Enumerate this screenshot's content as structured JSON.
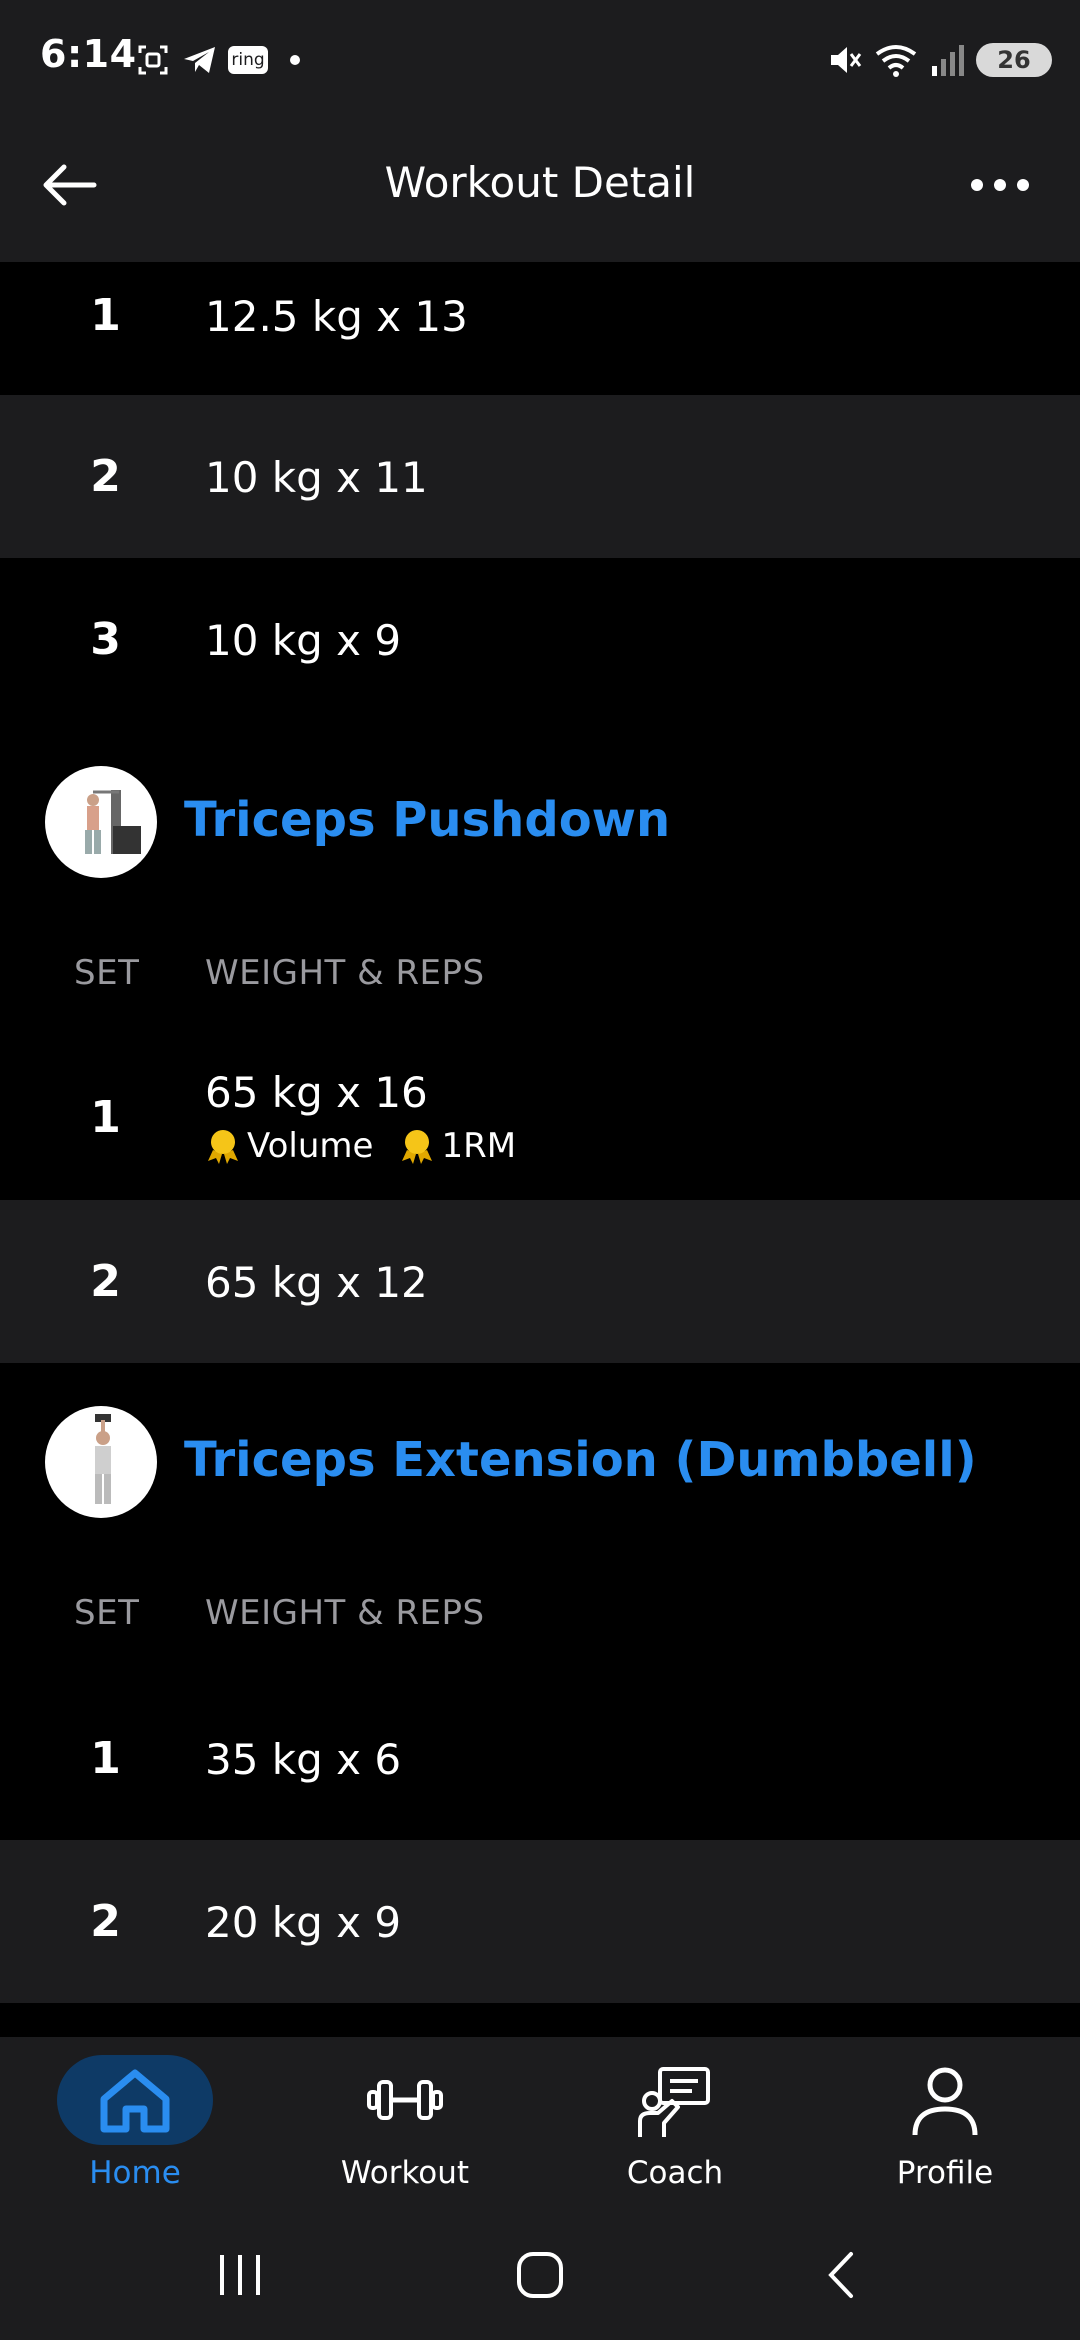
{
  "status_bar": {
    "time": "6:14",
    "battery": "26",
    "icons": [
      "screenshot-icon",
      "telegram-icon",
      "ring-icon",
      "dot-icon",
      "mute-icon",
      "wifi-icon",
      "signal-icon",
      "battery-icon"
    ],
    "ring_label": "ring"
  },
  "header": {
    "title": "Workout Detail"
  },
  "previous_exercise": {
    "sets": [
      {
        "set": "1",
        "value": "12.5 kg x 13"
      },
      {
        "set": "2",
        "value": "10 kg x 11"
      },
      {
        "set": "3",
        "value": "10 kg x 9"
      }
    ]
  },
  "exercises": [
    {
      "name": "Triceps Pushdown",
      "col_set": "SET",
      "col_weight": "WEIGHT & REPS",
      "sets": [
        {
          "set": "1",
          "value": "65 kg x 16",
          "badges": [
            "Volume",
            "1RM"
          ]
        },
        {
          "set": "2",
          "value": "65 kg x 12"
        }
      ]
    },
    {
      "name": "Triceps Extension (Dumbbell)",
      "col_set": "SET",
      "col_weight": "WEIGHT & REPS",
      "sets": [
        {
          "set": "1",
          "value": "35 kg x 6"
        },
        {
          "set": "2",
          "value": "20 kg x 9"
        }
      ]
    }
  ],
  "bottom_nav": {
    "items": [
      {
        "label": "Home",
        "icon": "home-icon",
        "active": true
      },
      {
        "label": "Workout",
        "icon": "dumbbell-icon"
      },
      {
        "label": "Coach",
        "icon": "coach-icon"
      },
      {
        "label": "Profile",
        "icon": "profile-icon"
      }
    ]
  },
  "colors": {
    "accent": "#2a8df0",
    "background": "#000000",
    "surface": "#1c1c1e",
    "badge_gold": "#f5c518",
    "muted_text": "#9a9a9f"
  }
}
